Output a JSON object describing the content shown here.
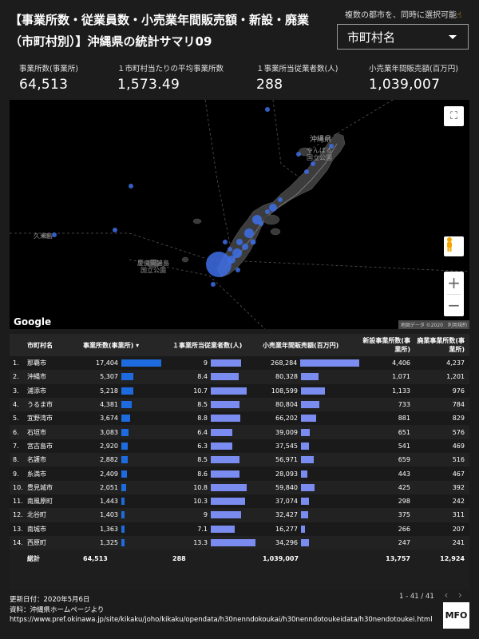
{
  "title": "【事業所数・従業員数・小売業年間販売額・新設・廃業（市町村別）】沖縄県の統計サマリ09",
  "filter": {
    "hint": "複数の都市を、同時に選択可能",
    "hand_icon": "pointing-hand-icon",
    "label": "市町村名"
  },
  "kpis": [
    {
      "label": "事業所数(事業所)",
      "value": "64,513"
    },
    {
      "label": "１市町村当たりの平均事業所数",
      "value": "1,573.49"
    },
    {
      "label": "１事業所当従業者数(人)",
      "value": "288"
    },
    {
      "label": "小売業年間販売額(百万円)",
      "value": "1,039,007"
    }
  ],
  "map": {
    "labels": {
      "okinawa": "沖縄県",
      "yanbaru": "やんばる",
      "yanbaru2": "国立公園",
      "kerama": "慶良間諸島",
      "kerama2": "国立公園",
      "kume": "久米島"
    },
    "google": "Google",
    "attribution": "地図データ ©2020　利用規約"
  },
  "table": {
    "headers": [
      "市町村名",
      "事業所数(事業所) ▾",
      "１事業所当従業者数(人)",
      "小売業年間販売額(百万円)",
      "新設事業所数(事業所)",
      "廃業事業所数(事業所)"
    ],
    "rows": [
      [
        "1.",
        "那覇市",
        "17,404",
        "9",
        "268,284",
        "4,406",
        "4,237"
      ],
      [
        "2.",
        "沖縄市",
        "5,307",
        "8.4",
        "80,328",
        "1,071",
        "1,201"
      ],
      [
        "3.",
        "浦添市",
        "5,218",
        "10.7",
        "108,599",
        "1,133",
        "976"
      ],
      [
        "4.",
        "うるま市",
        "4,381",
        "8.5",
        "80,804",
        "733",
        "784"
      ],
      [
        "5.",
        "宜野湾市",
        "3,674",
        "8.8",
        "66,202",
        "881",
        "829"
      ],
      [
        "6.",
        "石垣市",
        "3,083",
        "6.4",
        "39,009",
        "651",
        "576"
      ],
      [
        "7.",
        "宮古島市",
        "2,920",
        "6.3",
        "37,545",
        "541",
        "469"
      ],
      [
        "8.",
        "名護市",
        "2,882",
        "8.5",
        "56,971",
        "659",
        "516"
      ],
      [
        "9.",
        "糸満市",
        "2,409",
        "8.6",
        "28,093",
        "443",
        "467"
      ],
      [
        "10.",
        "豊見城市",
        "2,051",
        "10.8",
        "59,840",
        "425",
        "392"
      ],
      [
        "11.",
        "南風原町",
        "1,443",
        "10.3",
        "37,074",
        "298",
        "242"
      ],
      [
        "12.",
        "北谷町",
        "1,403",
        "9",
        "32,427",
        "375",
        "311"
      ],
      [
        "13.",
        "南城市",
        "1,363",
        "7.1",
        "16,277",
        "266",
        "207"
      ],
      [
        "14.",
        "西原町",
        "1,325",
        "13.3",
        "34,296",
        "247",
        "241"
      ]
    ],
    "bar_values": {
      "offices": [
        17404,
        5307,
        5218,
        4381,
        3674,
        3083,
        2920,
        2882,
        2409,
        2051,
        1443,
        1403,
        1363,
        1325
      ],
      "workers": [
        9,
        8.4,
        10.7,
        8.5,
        8.8,
        6.4,
        6.3,
        8.5,
        8.6,
        10.8,
        10.3,
        9,
        7.1,
        13.3
      ],
      "sales": [
        268284,
        80328,
        108599,
        80804,
        66202,
        39009,
        37545,
        56971,
        28093,
        59840,
        37074,
        32427,
        16277,
        34296
      ]
    },
    "total": {
      "label": "総計",
      "offices": "64,513",
      "workers": "288",
      "sales": "1,039,007",
      "new": "13,757",
      "closed": "12,924"
    },
    "pager": "1 - 41 / 41"
  },
  "footer": {
    "updated": "更新日付：2020年5月6日",
    "source": "資料：沖縄県ホームページより",
    "url": "https://www.pref.okinawa.jp/site/kikaku/joho/kikaku/opendata/h30nenndokoukai/h30nenndotoukeidata/h30nendotoukei.html",
    "logo": "MFO"
  },
  "colors": {
    "bar_blue": "#1e6be0",
    "bar_lavender": "#7b8cf0",
    "bubble": "#3d6fe6"
  }
}
